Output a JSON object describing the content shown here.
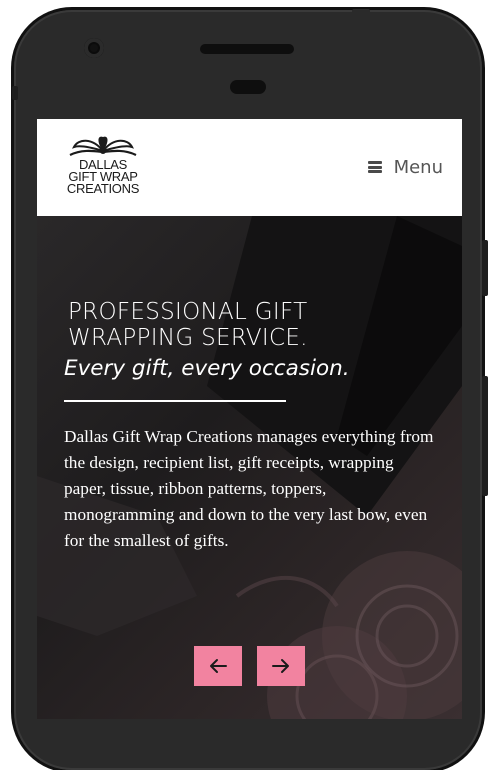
{
  "header": {
    "logo": {
      "lines": [
        "DALLAS",
        "GIFT WRAP",
        "CREATIONS"
      ],
      "icon": "bow-icon"
    },
    "menu": {
      "label": "Menu",
      "icon": "hamburger-icon"
    }
  },
  "hero": {
    "title_lines": [
      "PROFESSIONAL GIFT",
      "WRAPPING SERVICE."
    ],
    "subtitle": "Every gift, every occasion.",
    "body": "Dallas Gift Wrap Creations manages everything from the design, recipient list, gift receipts, wrapping paper, tissue, ribbon patterns, toppers, monogramming and down to the very last bow, even for the smallest of gifts.",
    "controls": {
      "prev_icon": "arrow-left-icon",
      "next_icon": "arrow-right-icon"
    }
  },
  "colors": {
    "accent": "#f283a0",
    "header_bg": "#ffffff",
    "hero_text": "#ffffff",
    "phone_frame": "#2a2a2a"
  }
}
